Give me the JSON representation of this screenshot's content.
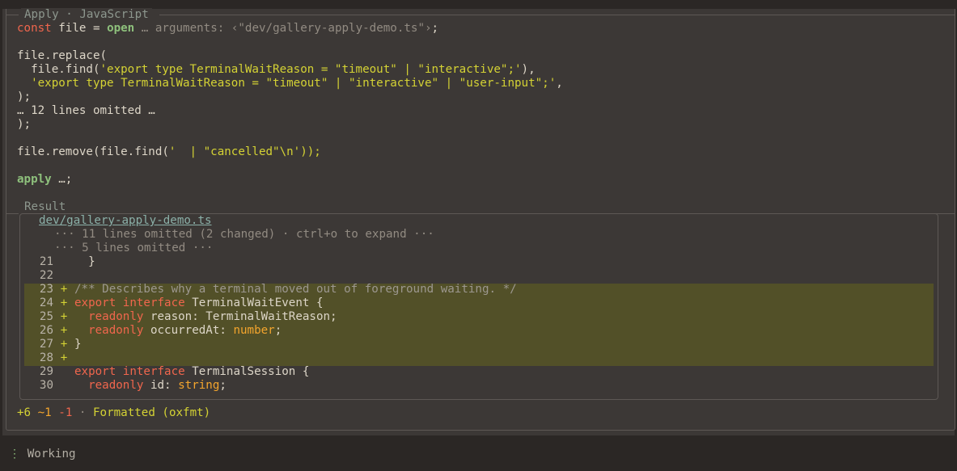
{
  "apply_block": {
    "legend_title": "Apply",
    "legend_sep": " · ",
    "legend_lang": "JavaScript",
    "code": {
      "l1_const": "const",
      "l1_file": " file = ",
      "l1_open": "open",
      "l1_ellipsis": " … arguments: ‹\"dev/gallery-apply-demo.ts\"›",
      "l1_semi": ";",
      "l3": "file.replace(",
      "l4_pre": "  file.find(",
      "l4_str": "'export type TerminalWaitReason = \"timeout\" | \"interactive\";'",
      "l4_post": "),",
      "l5_str": "  'export type TerminalWaitReason = \"timeout\" | \"interactive\" | \"user-input\";'",
      "l5_post": ",",
      "l6": ");",
      "l7": "… 12 lines omitted …",
      "l8": ");",
      "l10_pre": "file.remove(file.find(",
      "l10_str": "'  | \"cancelled\"\\n'",
      "l10_post": "));",
      "l12_apply": "apply",
      "l12_rest": " …;"
    }
  },
  "result_block": {
    "legend_title": "Result",
    "file_link": "dev/gallery-apply-demo.ts",
    "omit1": "··· 11 lines omitted (2 changed) · ctrl+o to expand ···",
    "omit2": "··· 5 lines omitted ···",
    "diff_lines": [
      {
        "n": "21",
        "s": "",
        "code": "  }"
      },
      {
        "n": "22",
        "s": "",
        "code": ""
      },
      {
        "n": "23",
        "s": "+",
        "code": "/** Describes why a terminal moved out of foreground waiting. */"
      },
      {
        "n": "24",
        "s": "+",
        "kw": "export interface",
        "code": " TerminalWaitEvent {"
      },
      {
        "n": "25",
        "s": "+",
        "kw": "  readonly",
        "code": " reason: TerminalWaitReason;"
      },
      {
        "n": "26",
        "s": "+",
        "kw": "  readonly",
        "code": " occurredAt: ",
        "type": "number",
        "tail": ";"
      },
      {
        "n": "27",
        "s": "+",
        "code": "}"
      },
      {
        "n": "28",
        "s": "+",
        "code": ""
      },
      {
        "n": "29",
        "s": "",
        "kw": "export interface",
        "code": " TerminalSession {"
      },
      {
        "n": "30",
        "s": "",
        "kw": "  readonly",
        "code": " id: ",
        "type": "string",
        "tail": ";"
      }
    ],
    "stats": {
      "added": "+6",
      "changed": "~1",
      "removed": "-1",
      "sep": " · ",
      "formatted": "Formatted (oxfmt)"
    }
  },
  "status": {
    "icon_glyph": "⋮",
    "label": "Working"
  },
  "colors": {
    "keyword": "#f0664d",
    "string": "#d4d234",
    "added_bg": "#525028",
    "number_type": "#f4a52d"
  }
}
